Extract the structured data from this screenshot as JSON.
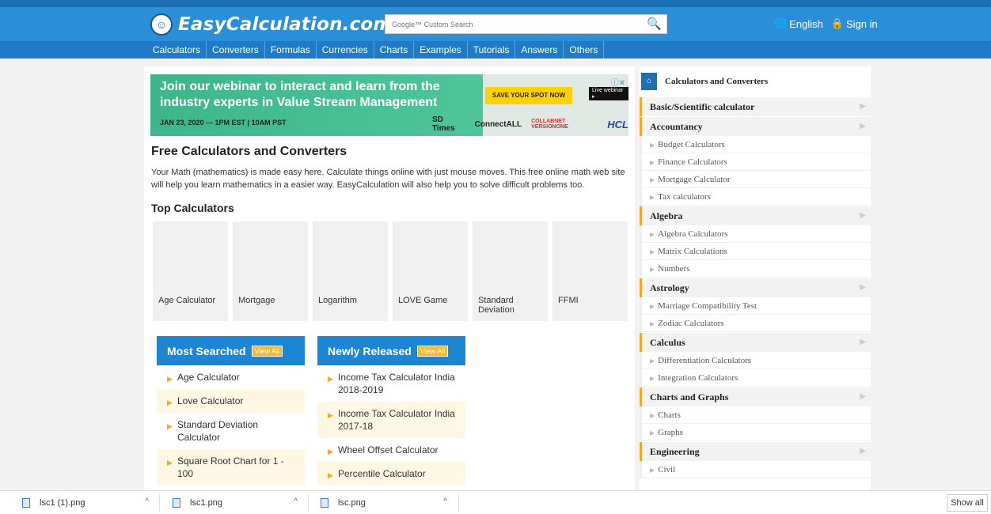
{
  "header": {
    "logo_text": "EasyCalculation.com",
    "search_placeholder": "Google™ Custom Search",
    "language": "English",
    "sign_in": "Sign in"
  },
  "nav": [
    "Calculators",
    "Converters",
    "Formulas",
    "Currencies",
    "Charts",
    "Examples",
    "Tutorials",
    "Answers",
    "Others"
  ],
  "ad": {
    "headline": "Join our webinar to interact and learn from the industry experts in Value Stream Management",
    "date": "JAN 23, 2020 — 1PM EST | 10AM PST",
    "cta": "SAVE YOUR SPOT NOW",
    "live": "Live webinar ▸",
    "logos": [
      "SD Times",
      "ConnectALL",
      "COLLABNET VERSIONONE",
      "HCL"
    ]
  },
  "main": {
    "title": "Free Calculators and Converters",
    "intro": "Your Math (mathematics) is made easy here. Calculate things online with just mouse moves. This free online math web site will help you learn mathematics in a easier way. EasyCalculation will also help you to solve difficult problems too.",
    "top_title": "Top Calculators",
    "top": [
      "Age Calculator",
      "Mortgage",
      "Logarithm",
      "LOVE Game",
      "Standard Deviation",
      "FFMI"
    ]
  },
  "most_searched": {
    "title": "Most Searched",
    "view_all": "View All",
    "items": [
      "Age Calculator",
      "Love Calculator",
      "Standard Deviation Calculator",
      "Square Root Chart for 1 - 100"
    ]
  },
  "newly_released": {
    "title": "Newly Released",
    "view_all": "View All",
    "items": [
      "Income Tax Calculator India 2018-2019",
      "Income Tax Calculator India 2017-18",
      "Wheel Offset Calculator",
      "Percentile Calculator"
    ]
  },
  "sidebar": {
    "title": "Calculators and Converters",
    "sections": [
      {
        "cat": "Basic/Scientific calculator",
        "subs": []
      },
      {
        "cat": "Accountancy",
        "subs": [
          "Budget Calculators",
          "Finance Calculators",
          "Mortgage Calculator",
          "Tax calculators"
        ]
      },
      {
        "cat": "Algebra",
        "subs": [
          "Algebra Calculators",
          "Matrix Calculations",
          "Numbers"
        ]
      },
      {
        "cat": "Astrology",
        "subs": [
          "Marriage Compatibility Test",
          "Zodiac Calculators"
        ]
      },
      {
        "cat": "Calculus",
        "subs": [
          "Differentiation Calculators",
          "Integration Calculators"
        ]
      },
      {
        "cat": "Charts and Graphs",
        "subs": [
          "Charts",
          "Graphs"
        ]
      },
      {
        "cat": "Engineering",
        "subs": [
          "Civil"
        ]
      }
    ]
  },
  "downloads": {
    "files": [
      "lsc1 (1).png",
      "lsc1.png",
      "lsc.png"
    ],
    "show_all": "Show all"
  }
}
